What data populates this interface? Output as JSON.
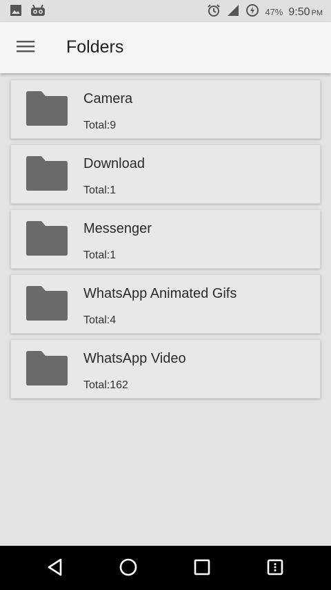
{
  "status_bar": {
    "battery": "47%",
    "time": "9:50",
    "ampm": "PM",
    "icons": [
      "image-icon",
      "app-notification-icon",
      "alarm-icon",
      "signal-icon",
      "battery-charging-icon"
    ]
  },
  "toolbar": {
    "title": "Folders",
    "menu_icon": "hamburger-menu-icon"
  },
  "folders": [
    {
      "name": "Camera",
      "total": "Total:9"
    },
    {
      "name": "Download",
      "total": "Total:1"
    },
    {
      "name": "Messenger",
      "total": "Total:1"
    },
    {
      "name": "WhatsApp Animated Gifs",
      "total": "Total:4"
    },
    {
      "name": "WhatsApp Video",
      "total": "Total:162"
    }
  ],
  "nav_bar": {
    "icons": [
      "back-icon",
      "home-icon",
      "recents-icon",
      "menu-icon"
    ]
  },
  "colors": {
    "background": "#e3e3e3",
    "card": "#e8e8e8",
    "folder_icon": "#6b6b6b",
    "toolbar": "#f5f5f5",
    "nav_bar": "#000000"
  }
}
